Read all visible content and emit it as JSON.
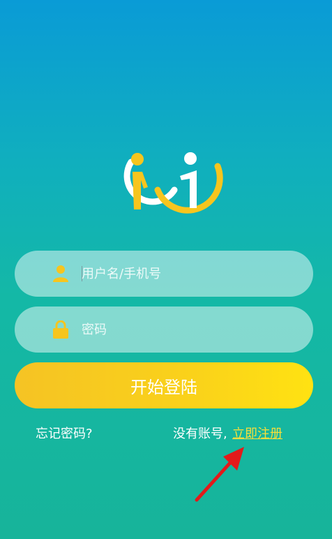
{
  "colors": {
    "accent": "#ffd21a",
    "link": "#f8df3a",
    "annotation": "#e31a1a"
  },
  "logo": {
    "icon": "wi-logo-icon"
  },
  "form": {
    "username": {
      "icon": "user-icon",
      "placeholder": "用户名/手机号",
      "value": ""
    },
    "password": {
      "icon": "lock-icon",
      "placeholder": "密码",
      "value": ""
    },
    "login_label": "开始登陆"
  },
  "footer": {
    "forgot_label": "忘记密码?",
    "no_account_label": "没有账号,",
    "register_label": "立即注册"
  }
}
